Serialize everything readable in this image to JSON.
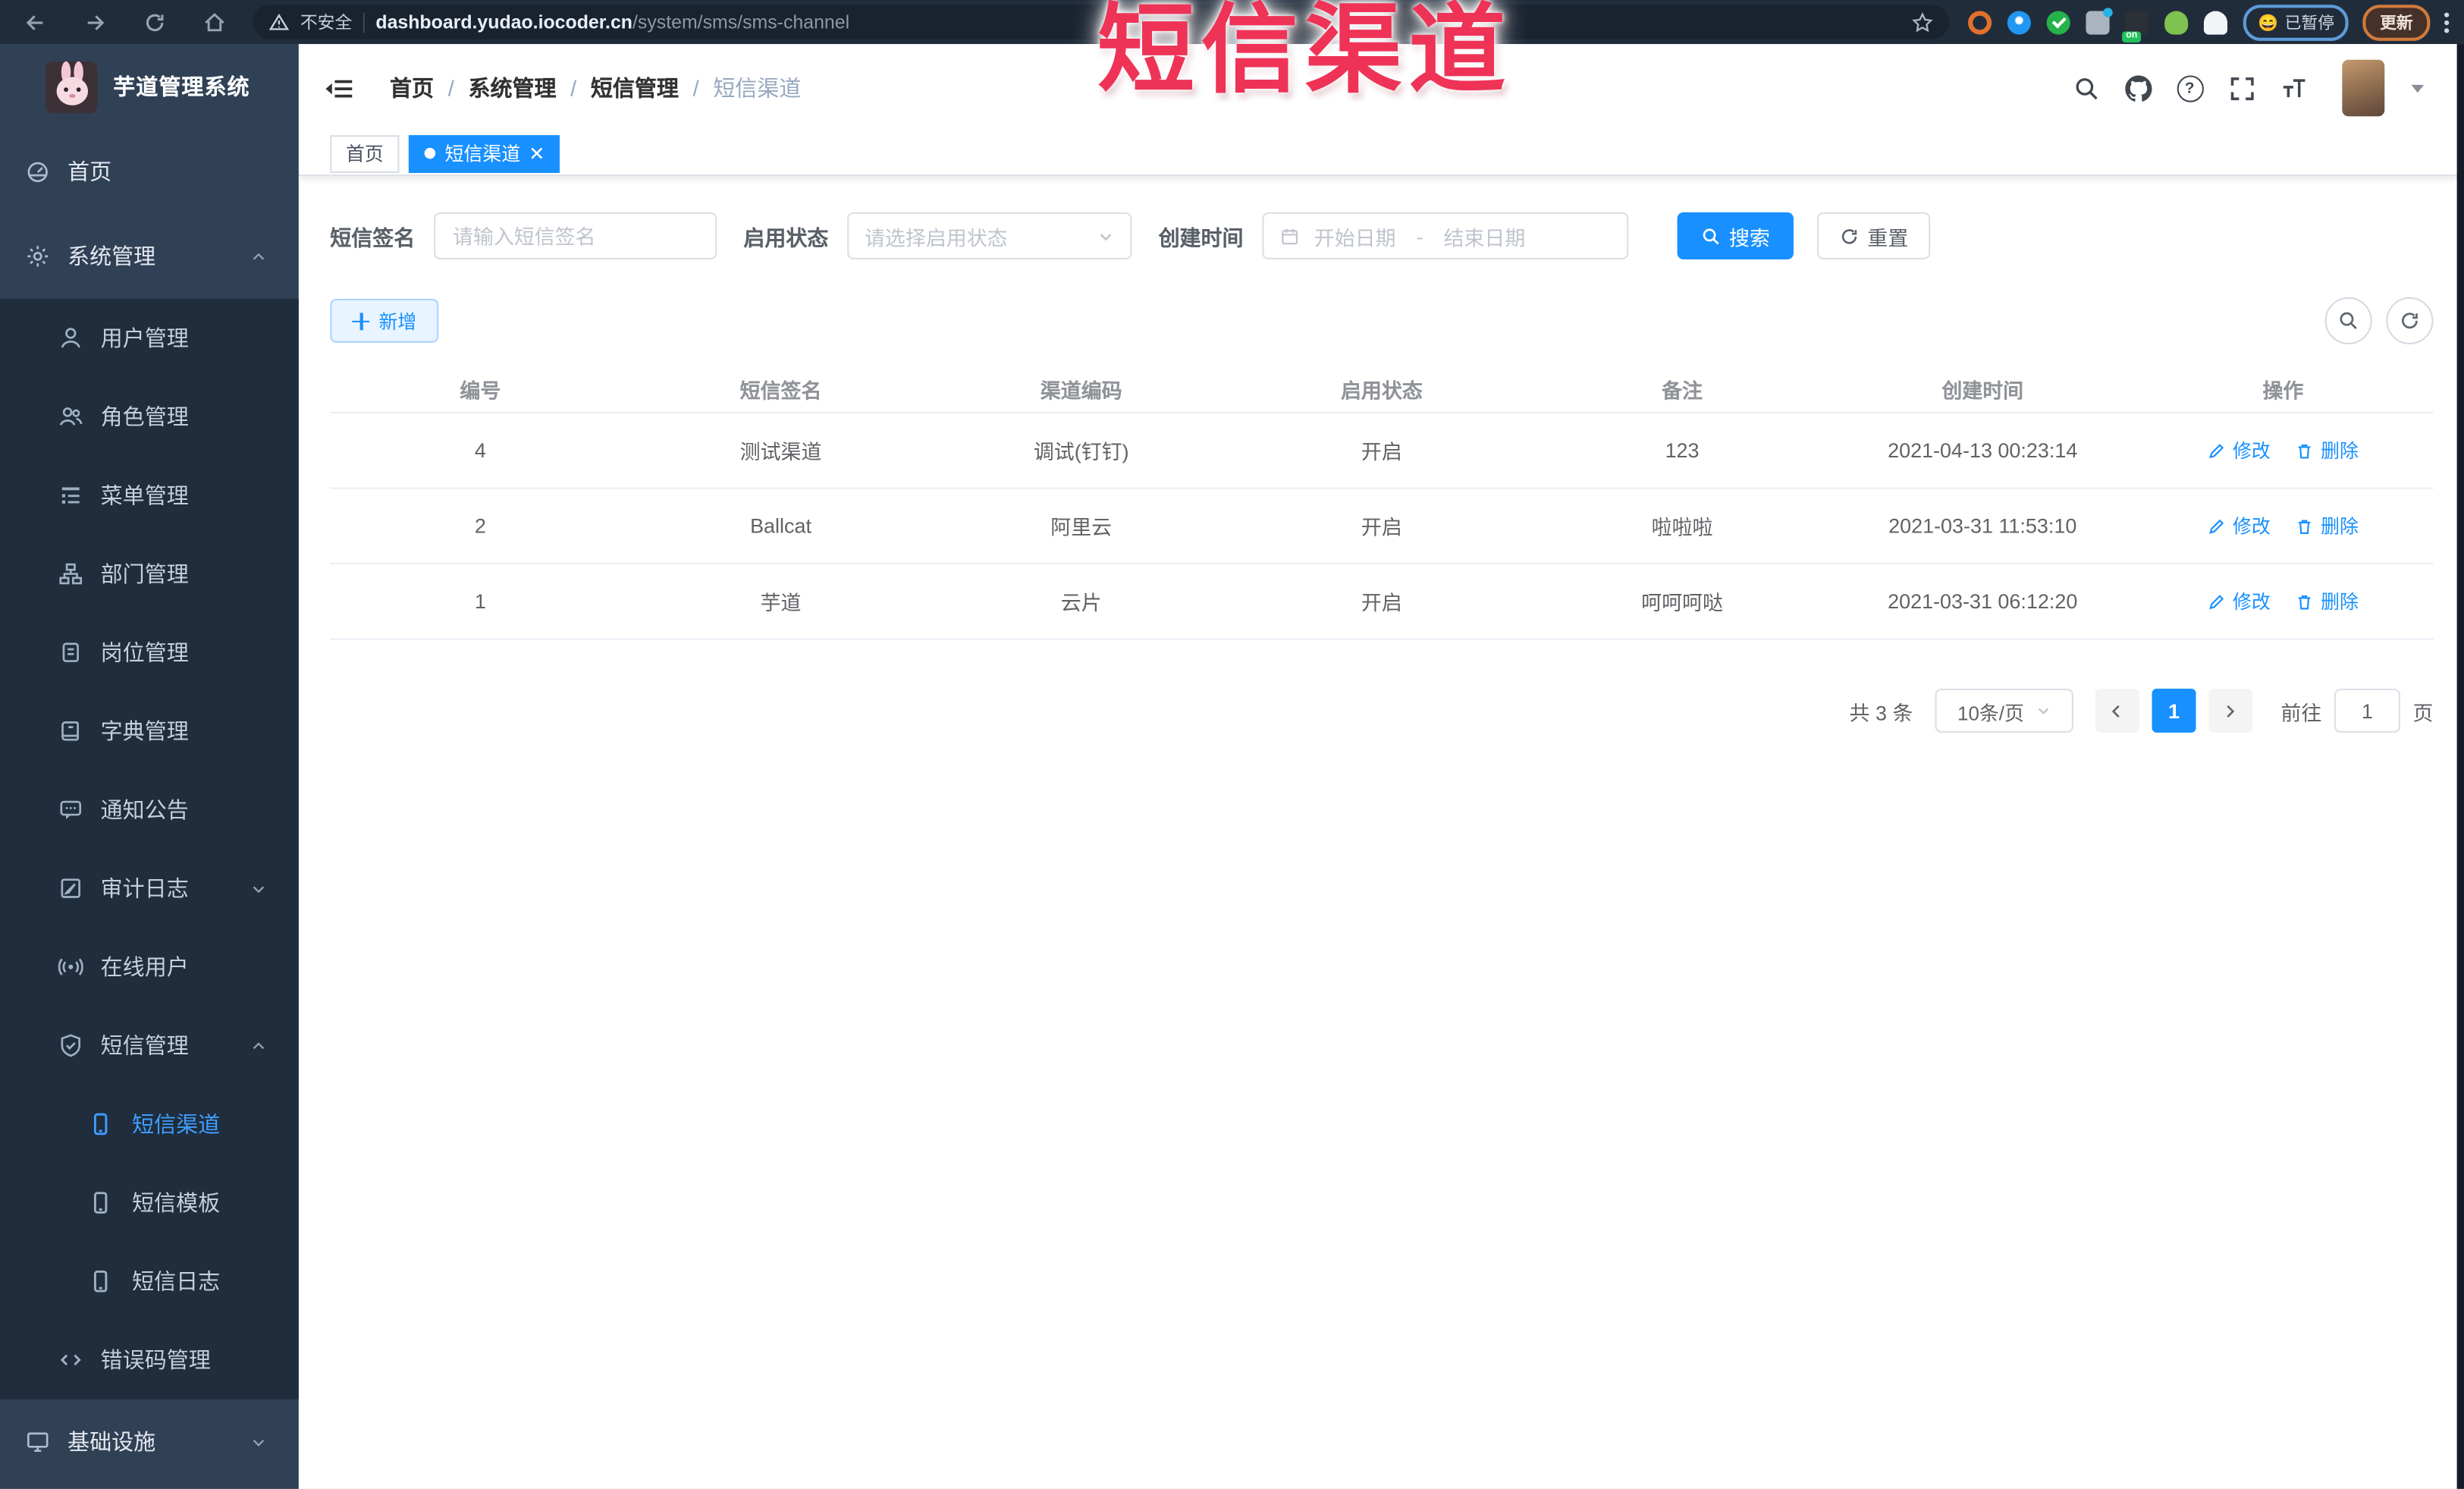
{
  "browser": {
    "security_label": "不安全",
    "url_host": "dashboard.yudao.iocoder.cn",
    "url_path": "/system/sms/sms-channel",
    "extension_badge": "on",
    "paused_emoji": "😄",
    "paused_label": "已暂停",
    "update_label": "更新"
  },
  "overlay": {
    "title": "短信渠道",
    "color": "#ee3357"
  },
  "sidebar": {
    "logo_title": "芋道管理系统",
    "items": [
      {
        "label": "首页",
        "icon": "dashboard-icon",
        "level": 0
      },
      {
        "label": "系统管理",
        "icon": "gear-icon",
        "level": 0,
        "state": "expanded"
      },
      {
        "label": "用户管理",
        "icon": "user-icon",
        "level": 1
      },
      {
        "label": "角色管理",
        "icon": "peoples-icon",
        "level": 1
      },
      {
        "label": "菜单管理",
        "icon": "tree-table-icon",
        "level": 1
      },
      {
        "label": "部门管理",
        "icon": "org-tree-icon",
        "level": 1
      },
      {
        "label": "岗位管理",
        "icon": "post-icon",
        "level": 1
      },
      {
        "label": "字典管理",
        "icon": "dict-icon",
        "level": 1
      },
      {
        "label": "通知公告",
        "icon": "message-icon",
        "level": 1
      },
      {
        "label": "审计日志",
        "icon": "log-icon",
        "level": 1,
        "state": "collapsed"
      },
      {
        "label": "在线用户",
        "icon": "online-icon",
        "level": 1
      },
      {
        "label": "短信管理",
        "icon": "shield-icon",
        "level": 1,
        "state": "expanded"
      },
      {
        "label": "短信渠道",
        "icon": "phone-icon",
        "level": 2,
        "active": true
      },
      {
        "label": "短信模板",
        "icon": "phone-icon",
        "level": 2
      },
      {
        "label": "短信日志",
        "icon": "phone-icon",
        "level": 2
      },
      {
        "label": "错误码管理",
        "icon": "code-icon",
        "level": 1
      },
      {
        "label": "基础设施",
        "icon": "monitor-icon",
        "level": 0,
        "state": "collapsed"
      }
    ]
  },
  "header": {
    "breadcrumb": [
      "首页",
      "系统管理",
      "短信管理",
      "短信渠道"
    ],
    "separator": "/"
  },
  "tabs": [
    {
      "label": "首页",
      "active": false
    },
    {
      "label": "短信渠道",
      "active": true
    }
  ],
  "filters": {
    "sign_label": "短信签名",
    "sign_placeholder": "请输入短信签名",
    "status_label": "启用状态",
    "status_placeholder": "请选择启用状态",
    "time_label": "创建时间",
    "date_start": "开始日期",
    "date_sep": "-",
    "date_end": "结束日期",
    "search_label": "搜索",
    "reset_label": "重置"
  },
  "toolbar": {
    "add_label": "新增"
  },
  "table": {
    "columns": [
      "编号",
      "短信签名",
      "渠道编码",
      "启用状态",
      "备注",
      "创建时间",
      "操作"
    ],
    "rows": [
      {
        "cells": [
          "4",
          "测试渠道",
          "调试(钉钉)",
          "开启",
          "123",
          "2021-04-13 00:23:14"
        ]
      },
      {
        "cells": [
          "2",
          "Ballcat",
          "阿里云",
          "开启",
          "啦啦啦",
          "2021-03-31 11:53:10"
        ]
      },
      {
        "cells": [
          "1",
          "芋道",
          "云片",
          "开启",
          "呵呵呵哒",
          "2021-03-31 06:12:20"
        ]
      }
    ],
    "ops": {
      "edit": "修改",
      "delete": "删除"
    }
  },
  "pagination": {
    "total": "共 3 条",
    "page_size": "10条/页",
    "page": "1",
    "goto_label": "前往",
    "goto_value": "1",
    "unit_label": "页"
  },
  "icons": {
    "help_glyph": "?"
  }
}
